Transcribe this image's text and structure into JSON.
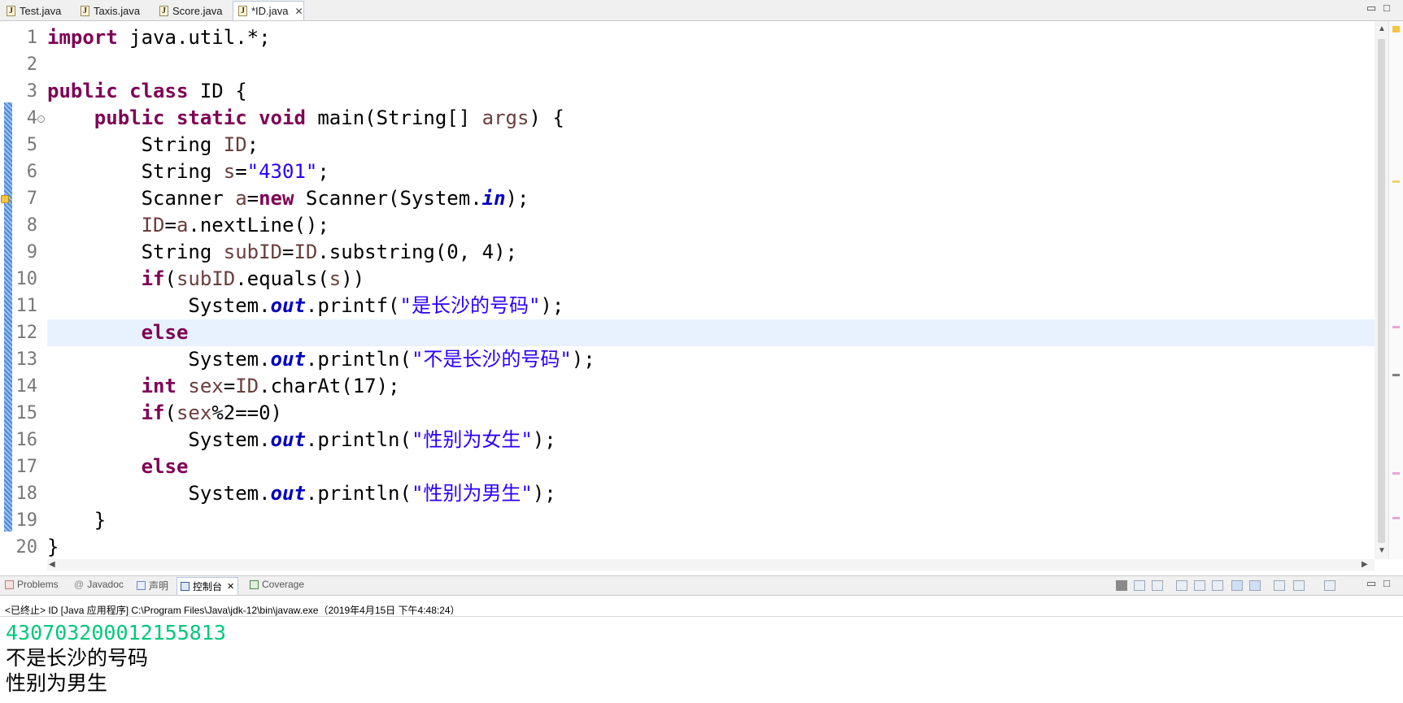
{
  "editor_tabs": [
    {
      "label": "Test.java"
    },
    {
      "label": "Taxis.java"
    },
    {
      "label": "Score.java"
    },
    {
      "label": "*ID.java",
      "close": "✕"
    }
  ],
  "code_lines": [
    {
      "n": "1",
      "html": "<span class=\"kw\">import</span> java.util.*;"
    },
    {
      "n": "2",
      "html": ""
    },
    {
      "n": "3",
      "html": "<span class=\"kw\">public</span> <span class=\"kw\">class</span> ID {"
    },
    {
      "n": "4",
      "html": "    <span class=\"kw\">public</span> <span class=\"kw\">static</span> <span class=\"kw\">void</span> main(String[] <span class=\"var\">args</span>) {"
    },
    {
      "n": "5",
      "html": "        String <span class=\"var\">ID</span>;"
    },
    {
      "n": "6",
      "html": "        String <span class=\"var\">s</span>=<span class=\"str\">\"4301\"</span>;"
    },
    {
      "n": "7",
      "html": "        Scanner <span class=\"var\">a</span>=<span class=\"kw\">new</span> Scanner(System.<span class=\"fld\">in</span>);"
    },
    {
      "n": "8",
      "html": "        <span class=\"var\">ID</span>=<span class=\"var\">a</span>.nextLine();"
    },
    {
      "n": "9",
      "html": "        String <span class=\"var\">subID</span>=<span class=\"var\">ID</span>.substring(0, 4);"
    },
    {
      "n": "10",
      "html": "        <span class=\"kw\">if</span>(<span class=\"var\">subID</span>.equals(<span class=\"var\">s</span>))"
    },
    {
      "n": "11",
      "html": "            System.<span class=\"fld\">out</span>.printf(<span class=\"str\">\"是长沙的号码\"</span>);"
    },
    {
      "n": "12",
      "html": "        <span class=\"kw\">else</span>"
    },
    {
      "n": "13",
      "html": "            System.<span class=\"fld\">out</span>.println(<span class=\"str\">\"不是长沙的号码\"</span>);"
    },
    {
      "n": "14",
      "html": "        <span class=\"kw\">int</span> <span class=\"var\">sex</span>=<span class=\"var\">ID</span>.charAt(17);"
    },
    {
      "n": "15",
      "html": "        <span class=\"kw\">if</span>(<span class=\"var\">sex</span>%2==0)"
    },
    {
      "n": "16",
      "html": "            System.<span class=\"fld\">out</span>.println(<span class=\"str\">\"性别为女生\"</span>);"
    },
    {
      "n": "17",
      "html": "        <span class=\"kw\">else</span>"
    },
    {
      "n": "18",
      "html": "            System.<span class=\"fld\">out</span>.println(<span class=\"str\">\"性别为男生\"</span>);"
    },
    {
      "n": "19",
      "html": "    }"
    },
    {
      "n": "20",
      "html": "}"
    }
  ],
  "highlighted_line": "12",
  "console_tabs": [
    {
      "label": "Problems"
    },
    {
      "label": "Javadoc"
    },
    {
      "label": "声明"
    },
    {
      "label": "控制台",
      "close": "✕"
    },
    {
      "label": "Coverage"
    }
  ],
  "console_header": "<已终止> ID [Java 应用程序] C:\\Program Files\\Java\\jdk-12\\bin\\javaw.exe（2019年4月15日 下午4:48:24）",
  "console_output": [
    {
      "text": "430703200012155813",
      "color": "#00c87a"
    },
    {
      "text": "不是长沙的号码",
      "color": "#000000"
    },
    {
      "text": "性别为男生",
      "color": "#000000"
    }
  ],
  "window_controls": {
    "minimize": "▭",
    "maximize": "□"
  }
}
